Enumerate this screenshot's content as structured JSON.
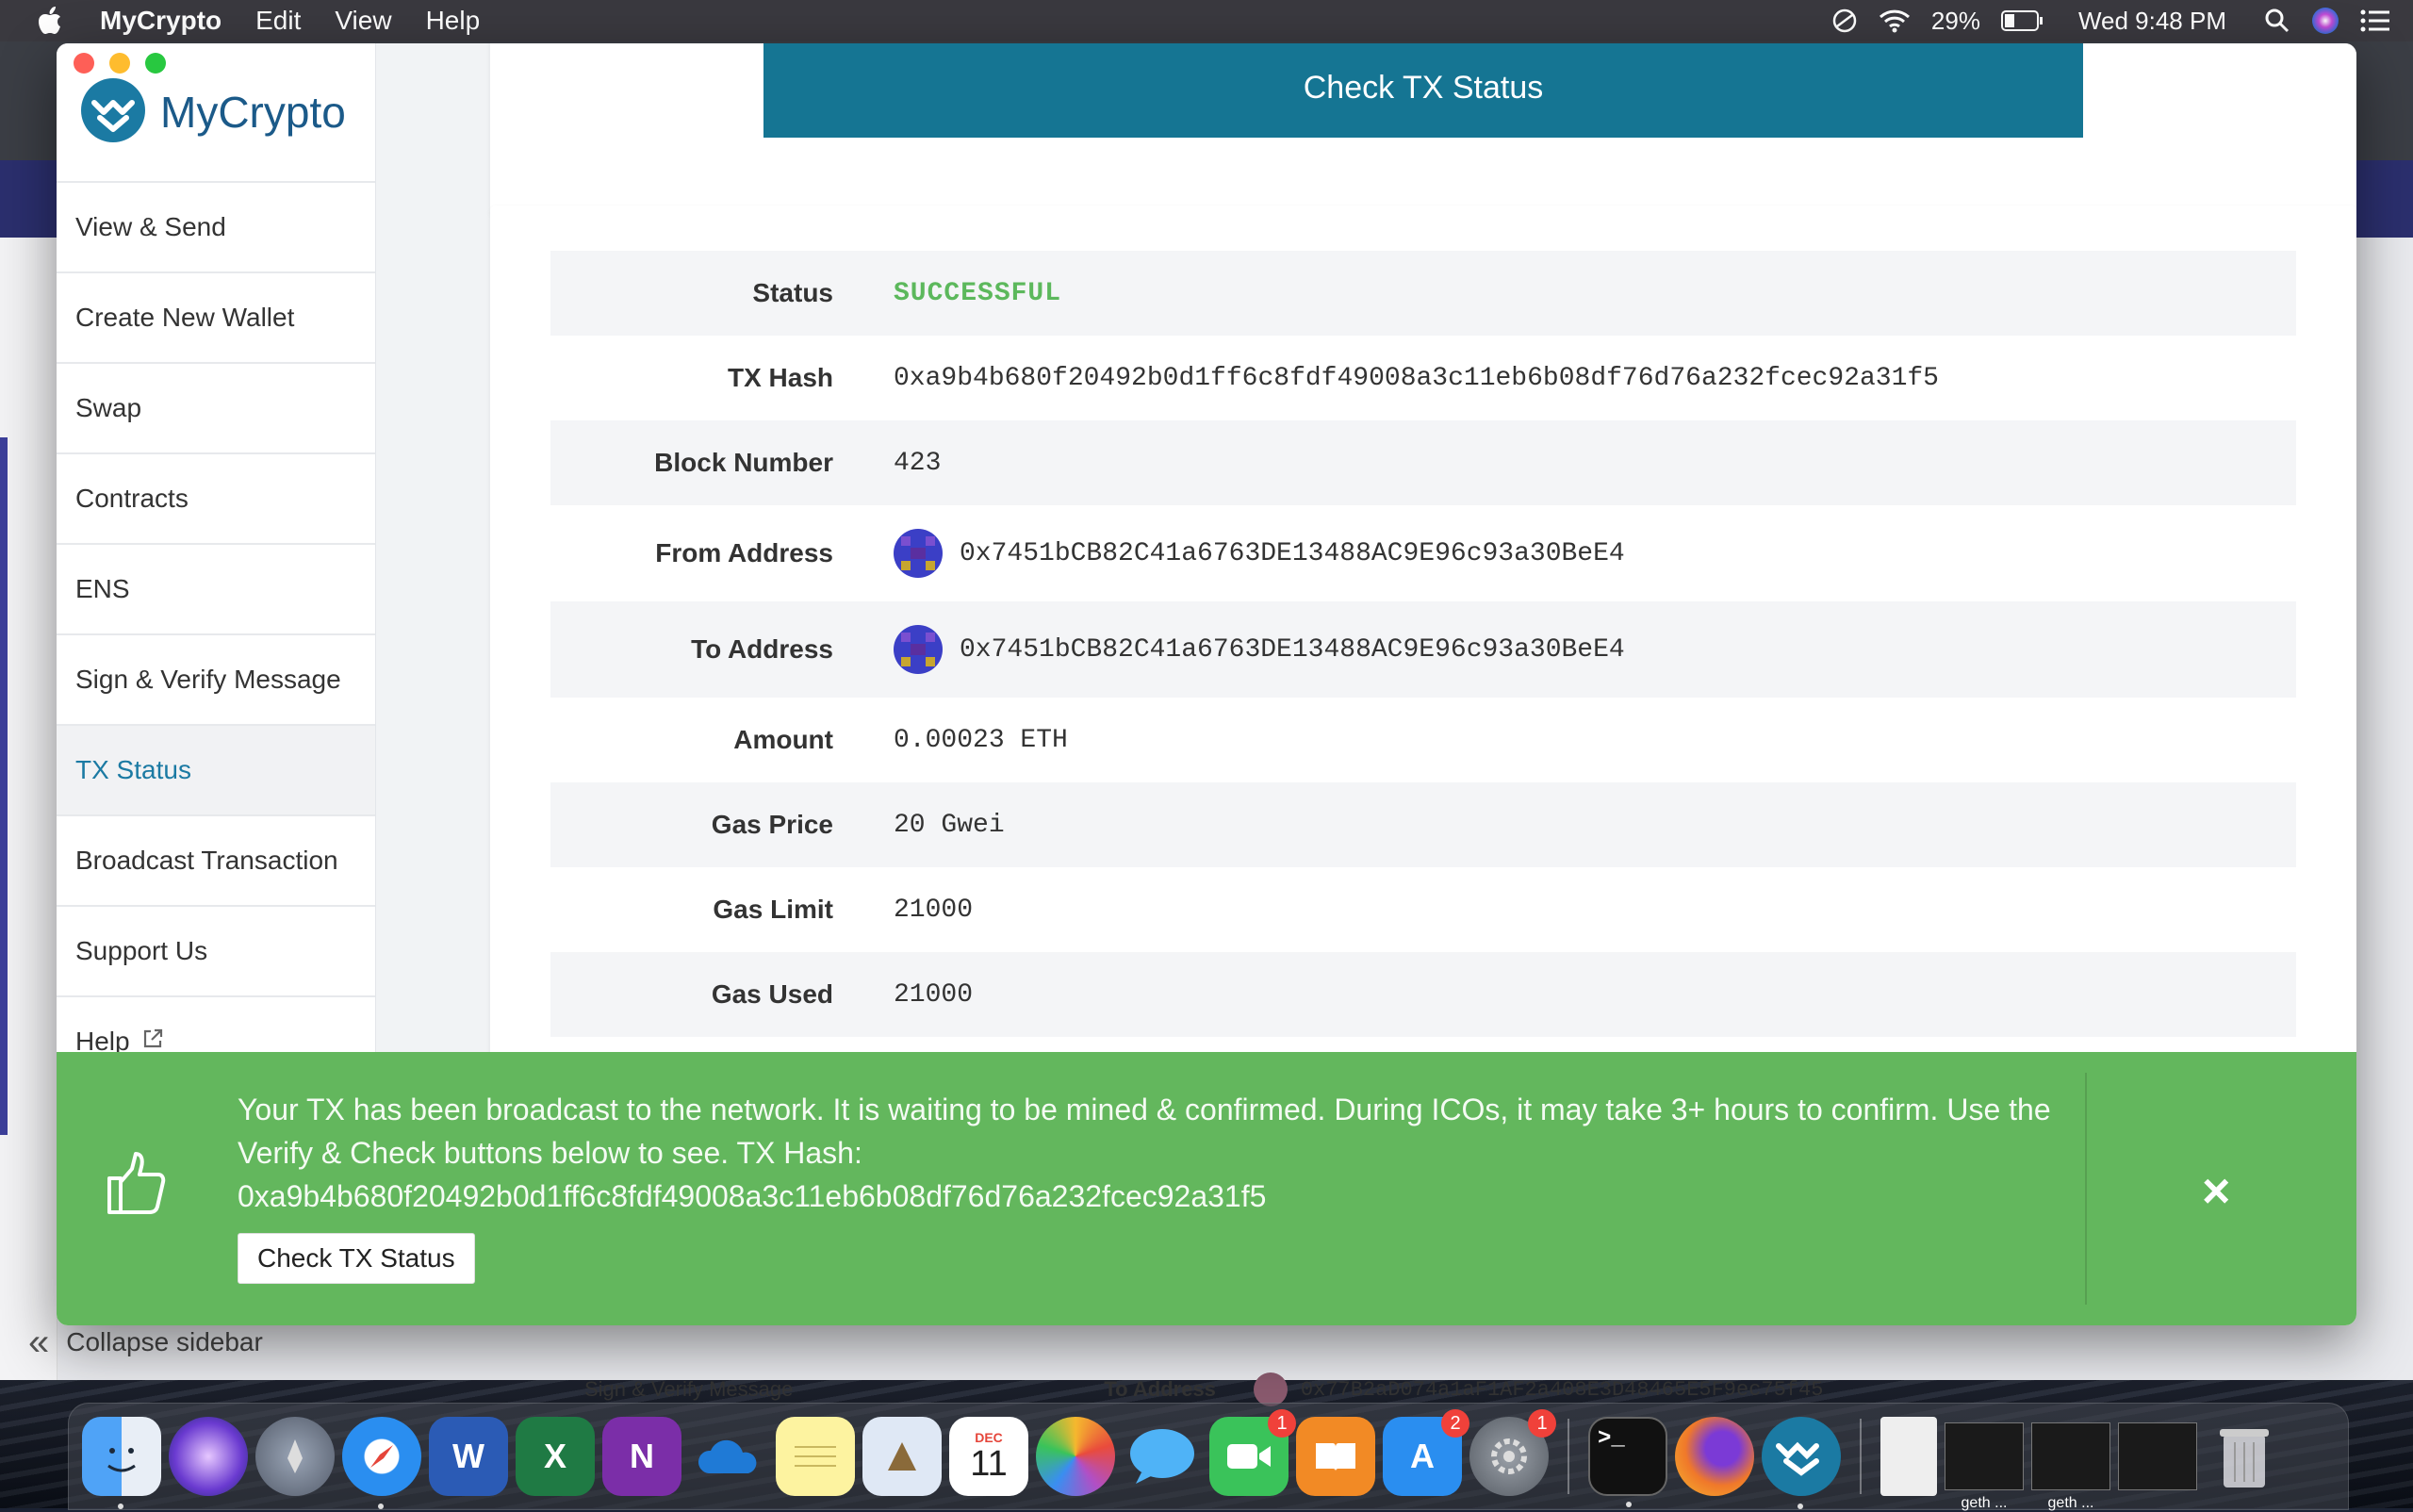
{
  "menubar": {
    "app_name": "MyCrypto",
    "menus": [
      "Edit",
      "View",
      "Help"
    ],
    "battery": "29%",
    "clock": "Wed 9:48 PM"
  },
  "background_window": {
    "collapse_label": "Collapse sidebar",
    "strip_sign_verify": "Sign & Verify Message",
    "strip_to_address_label": "To Address",
    "strip_to_address": "0x77B2aD074a1aF1AF2a408E3D48465E5F9ec75f45"
  },
  "sidebar": {
    "brand": "MyCrypto",
    "items": [
      {
        "label": "View & Send"
      },
      {
        "label": "Create New Wallet"
      },
      {
        "label": "Swap"
      },
      {
        "label": "Contracts"
      },
      {
        "label": "ENS"
      },
      {
        "label": "Sign & Verify Message"
      },
      {
        "label": "TX Status"
      },
      {
        "label": "Broadcast Transaction"
      },
      {
        "label": "Support Us"
      },
      {
        "label": "Help"
      }
    ]
  },
  "main": {
    "check_button": "Check TX Status",
    "rows": [
      {
        "label": "Status",
        "value": "SUCCESSFUL"
      },
      {
        "label": "TX Hash",
        "value": "0xa9b4b680f20492b0d1ff6c8fdf49008a3c11eb6b08df76d76a232fcec92a31f5"
      },
      {
        "label": "Block Number",
        "value": "423"
      },
      {
        "label": "From Address",
        "value": "0x7451bCB82C41a6763DE13488AC9E96c93a30BeE4"
      },
      {
        "label": "To Address",
        "value": "0x7451bCB82C41a6763DE13488AC9E96c93a30BeE4"
      },
      {
        "label": "Amount",
        "value": "0.00023 ETH"
      },
      {
        "label": "Gas Price",
        "value": "20 Gwei"
      },
      {
        "label": "Gas Limit",
        "value": "21000"
      },
      {
        "label": "Gas Used",
        "value": "21000"
      }
    ],
    "status_color": "#5cb85c"
  },
  "notification": {
    "message": "Your TX has been broadcast to the network. It is waiting to be mined & confirmed. During ICOs, it may take 3+ hours to confirm. Use the Verify & Check buttons below to see. TX Hash:",
    "hash": "0xa9b4b680f20492b0d1ff6c8fdf49008a3c11eb6b08df76d76a232fcec92a31f5",
    "button": "Check TX Status",
    "close": "×",
    "color": "#63b75d"
  },
  "dock": {
    "calendar_month": "DEC",
    "calendar_day": "11",
    "badges": {
      "facetime": "1",
      "appstore": "2",
      "settings": "1"
    },
    "thumb_labels": [
      "geth ...",
      "geth ..."
    ]
  }
}
